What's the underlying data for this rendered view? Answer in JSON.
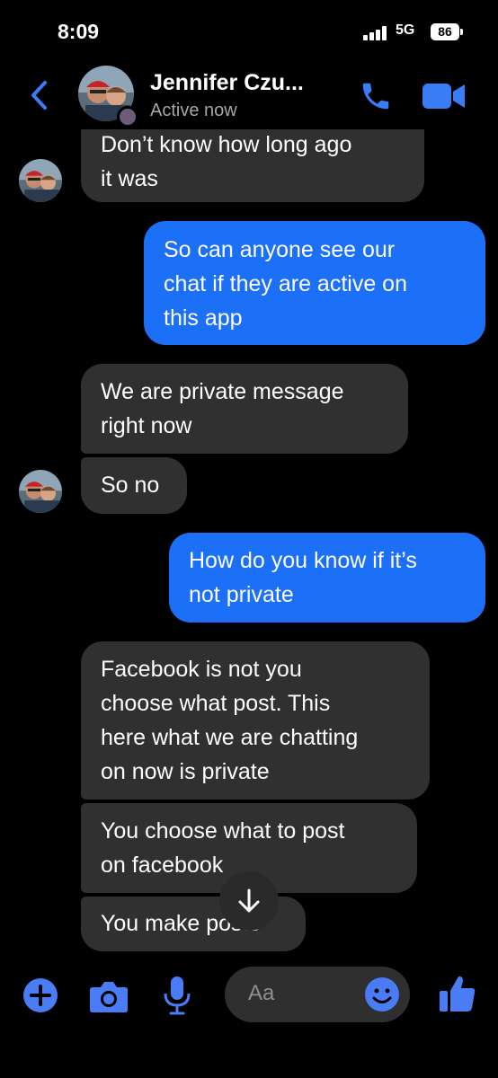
{
  "status_bar": {
    "time": "8:09",
    "network": "5G",
    "battery": "86"
  },
  "header": {
    "contact_name": "Jennifer Czu...",
    "status": "Active now",
    "icons": [
      "back-chevron-icon",
      "phone-icon",
      "video-camera-icon"
    ]
  },
  "messages": [
    {
      "direction": "incoming",
      "lines": [
        "Don’t know how long ago",
        "it was"
      ]
    },
    {
      "direction": "outgoing",
      "lines": [
        "So can anyone see our",
        "chat if  they are active on",
        "this app"
      ]
    },
    {
      "direction": "incoming",
      "lines": [
        "We are private message",
        "right now"
      ]
    },
    {
      "direction": "incoming",
      "lines": [
        "So no"
      ]
    },
    {
      "direction": "outgoing",
      "lines": [
        "How do you know if it’s",
        "not private"
      ]
    },
    {
      "direction": "incoming",
      "lines": [
        "Facebook is not you",
        "choose what post. This",
        "here what we are chatting",
        "on now is private"
      ]
    },
    {
      "direction": "incoming",
      "lines": [
        "You choose what to post",
        "on facebook"
      ]
    },
    {
      "direction": "incoming",
      "lines": [
        "You make posts"
      ]
    }
  ],
  "composer": {
    "placeholder": "Aa",
    "icons": [
      "plus-icon",
      "camera-icon",
      "microphone-icon",
      "emoji-icon",
      "thumbs-up-icon"
    ]
  },
  "colors": {
    "accent": "#1c6ff7",
    "icon_blue": "#4a7cf5",
    "incoming_bubble": "#303030",
    "background": "#000000"
  }
}
